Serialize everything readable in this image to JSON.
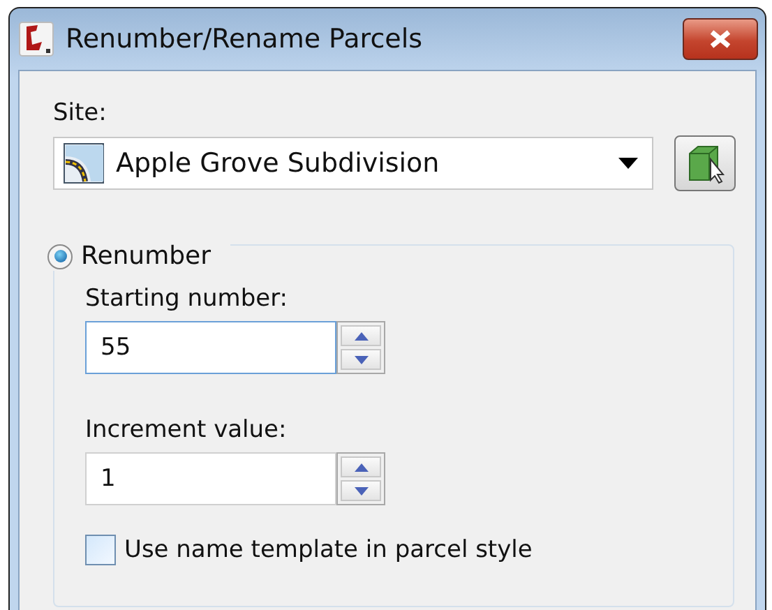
{
  "window": {
    "title": "Renumber/Rename Parcels"
  },
  "site": {
    "label": "Site:",
    "value": "Apple Grove Subdivision"
  },
  "renumber": {
    "label": "Renumber",
    "selected": true,
    "fields": [
      {
        "label": "Starting number:",
        "value": "55",
        "focused": true
      },
      {
        "label": "Increment value:",
        "value": "1",
        "focused": false
      }
    ],
    "use_name_template": {
      "label": "Use name template in parcel style",
      "checked": false
    }
  }
}
